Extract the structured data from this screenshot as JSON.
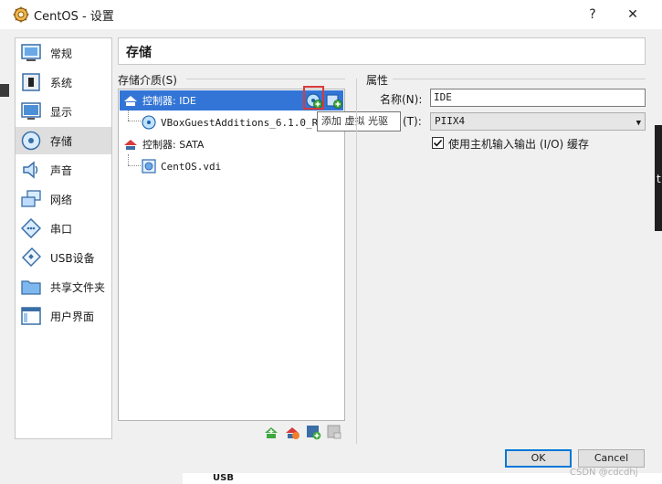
{
  "window": {
    "title": "CentOS - 设置",
    "help_label": "?",
    "close_label": "✕"
  },
  "nav": {
    "items": [
      {
        "label": "常规",
        "icon": "general-icon"
      },
      {
        "label": "系统",
        "icon": "system-icon"
      },
      {
        "label": "显示",
        "icon": "display-icon"
      },
      {
        "label": "存储",
        "icon": "storage-icon",
        "selected": true
      },
      {
        "label": "声音",
        "icon": "audio-icon"
      },
      {
        "label": "网络",
        "icon": "network-icon"
      },
      {
        "label": "串口",
        "icon": "serial-port-icon"
      },
      {
        "label": "USB设备",
        "icon": "usb-icon"
      },
      {
        "label": "共享文件夹",
        "icon": "shared-folder-icon"
      },
      {
        "label": "用户界面",
        "icon": "user-interface-icon"
      }
    ]
  },
  "page": {
    "title": "存储"
  },
  "storage": {
    "group_label": "存储介质(S)",
    "tree": [
      {
        "label": "控制器: IDE",
        "type": "controller",
        "selected": true
      },
      {
        "label": "VBoxGuestAdditions_6.1.0_RC1",
        "type": "optical"
      },
      {
        "label": "控制器: SATA",
        "type": "controller"
      },
      {
        "label": "CentOS.vdi",
        "type": "disk"
      }
    ],
    "tooltip": "添加 虚拟 光驱"
  },
  "attributes": {
    "group_label": "属性",
    "name_label": "名称(N):",
    "name_value": "IDE",
    "type_label": "(T):",
    "type_value": "PIIX4",
    "host_io_label": "使用主机输入输出 (I/O) 缓存",
    "host_io_checked": true
  },
  "buttons": {
    "ok": "OK",
    "cancel": "Cancel"
  },
  "background": {
    "right_char": "t",
    "bottom_text": "USB"
  },
  "watermark": "CSDN @cdcdhj",
  "colors": {
    "selection": "#3375d6",
    "highlight": "#d83a3a",
    "default_button": "#0078d7"
  }
}
